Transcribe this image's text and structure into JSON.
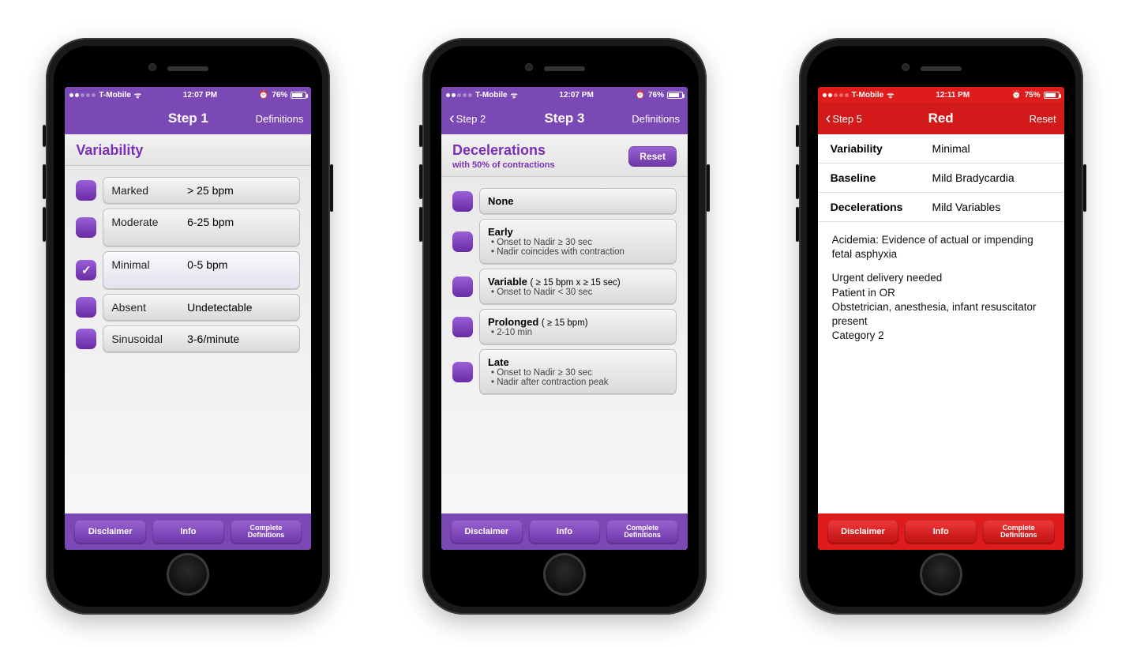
{
  "status": {
    "carrier": "T-Mobile",
    "time_a": "12:07 PM",
    "time_b": "12:07 PM",
    "time_c": "12:11 PM",
    "battery_a": "76%",
    "battery_b": "76%",
    "battery_c": "75%",
    "alarm_icon": "⏰"
  },
  "phone1": {
    "nav": {
      "title": "Step 1",
      "right": "Definitions"
    },
    "subhead": {
      "title": "Variability"
    },
    "options": [
      {
        "label": "Marked",
        "value": "> 25 bpm",
        "checked": false
      },
      {
        "label": "Moderate",
        "value": "6-25 bpm",
        "checked": false
      },
      {
        "label": "Minimal",
        "value": "0-5 bpm",
        "checked": true
      },
      {
        "label": "Absent",
        "value": "Undetectable",
        "checked": false
      },
      {
        "label": "Sinusoidal",
        "value": "3-6/minute",
        "checked": false
      }
    ]
  },
  "phone2": {
    "nav": {
      "back": "Step 2",
      "title": "Step 3",
      "right": "Definitions"
    },
    "subhead": {
      "title": "Decelerations",
      "sub": "with 50% of contractions",
      "reset": "Reset"
    },
    "options": [
      {
        "title": "None",
        "bullets": []
      },
      {
        "title": "Early",
        "qual": "",
        "bullets": [
          "Onset to Nadir ≥ 30 sec",
          "Nadir coincides with contraction"
        ]
      },
      {
        "title": "Variable",
        "qual": "( ≥ 15 bpm x ≥ 15 sec)",
        "bullets": [
          "Onset to Nadir < 30 sec"
        ]
      },
      {
        "title": "Prolonged",
        "qual": "( ≥ 15 bpm)",
        "bullets": [
          "2-10 min"
        ]
      },
      {
        "title": "Late",
        "qual": "",
        "bullets": [
          "Onset to Nadir ≥ 30 sec",
          "Nadir after contraction peak"
        ]
      }
    ]
  },
  "phone3": {
    "nav": {
      "back": "Step 5",
      "title": "Red",
      "right": "Reset"
    },
    "rows": [
      {
        "k": "Variability",
        "v": "Minimal"
      },
      {
        "k": "Baseline",
        "v": "Mild Bradycardia"
      },
      {
        "k": "Decelerations",
        "v": "Mild Variables"
      }
    ],
    "body": {
      "p1": "Acidemia: Evidence of actual or impending fetal asphyxia",
      "lines": [
        "Urgent delivery needed",
        "Patient in OR",
        "Obstetrician, anesthesia, infant resuscitator present",
        "Category 2"
      ]
    }
  },
  "bottom": {
    "disclaimer": "Disclaimer",
    "info": "Info",
    "complete": "Complete\nDefinitions"
  }
}
